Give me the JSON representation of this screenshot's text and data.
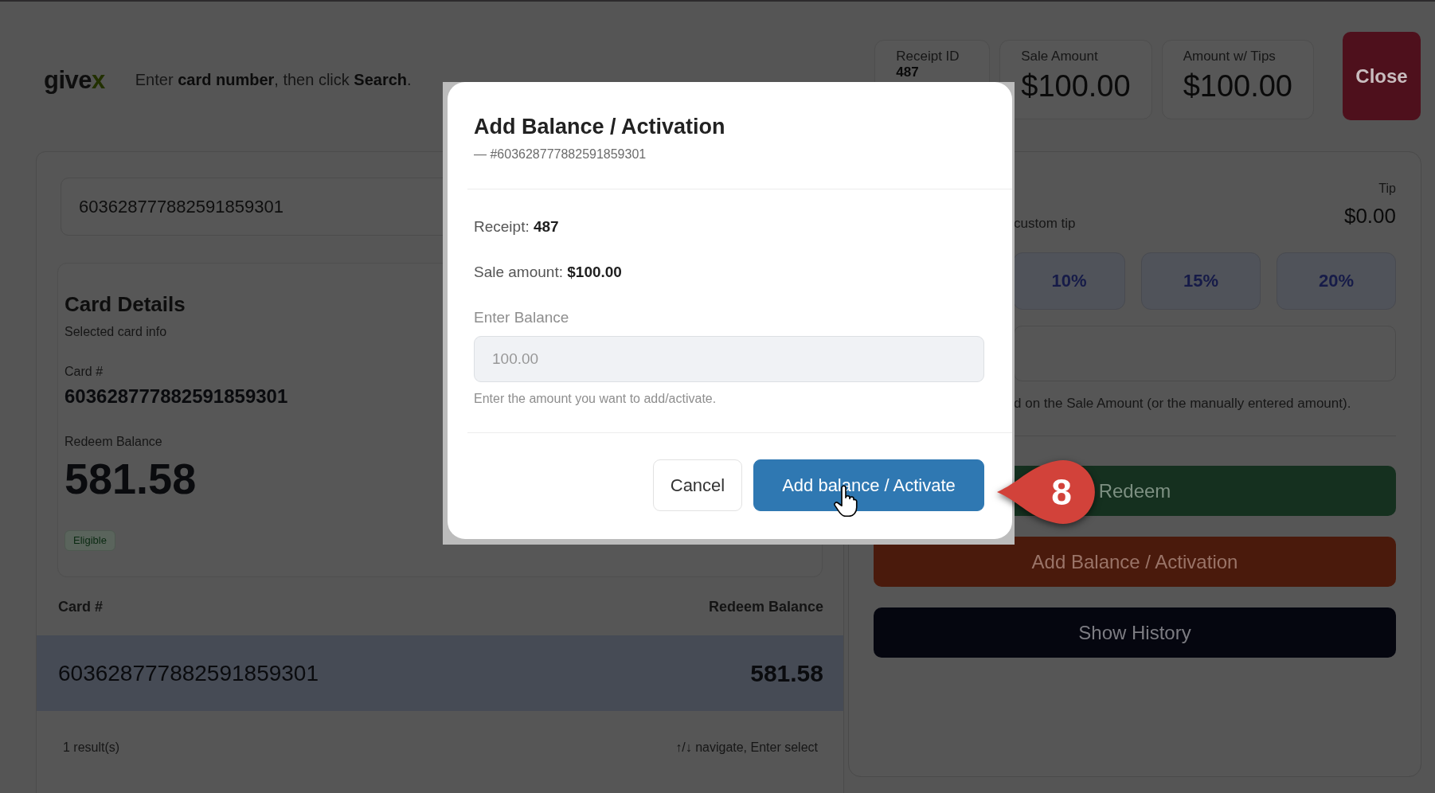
{
  "header": {
    "logo": {
      "text": "give",
      "accent": "x"
    },
    "hint": "Enter **card number**, then click **Search**.",
    "stats": [
      {
        "label": "Receipt ID",
        "value": "487",
        "kind": "small"
      },
      {
        "label": "Sale Amount",
        "value": "$100.00",
        "kind": "large"
      },
      {
        "label": "Amount w/ Tips",
        "value": "$100.00",
        "kind": "large"
      }
    ],
    "close_button": "Close"
  },
  "search": {
    "value": "603628777882591859301"
  },
  "card_details": {
    "title": "Card Details",
    "subtitle": "Selected card info",
    "fields": [
      {
        "label": "Card #",
        "value": "603628777882591859301",
        "kind": "text"
      },
      {
        "label": "Redeem Balance",
        "value": "581.58",
        "kind": "amount"
      }
    ],
    "badge": "Eligible"
  },
  "results": {
    "columns": [
      "Card #",
      "Redeem Balance"
    ],
    "rows": [
      {
        "card": "603628777882591859301",
        "balance": "581.58",
        "selected": true
      }
    ],
    "count": "1 result(s)",
    "hint": "↑/↓ navigate, Enter select"
  },
  "tip": {
    "label": "Tip",
    "amount": "$0.00",
    "prompt": "custom tip",
    "presets": [
      {
        "label": "10%",
        "selected": false
      },
      {
        "label": "15%",
        "selected": false
      },
      {
        "label": "20%",
        "selected": false
      }
    ],
    "note": "d on the Sale Amount (or the manually entered amount)."
  },
  "actions": [
    {
      "label": "Redeem",
      "kind": "redeem"
    },
    {
      "label": "Add Balance / Activation",
      "kind": "activate"
    },
    {
      "label": "Show History",
      "kind": "history"
    }
  ],
  "modal": {
    "title": "Add Balance / Activation",
    "subtitle": "— #603628777882591859301",
    "lines": [
      "Receipt: **487**",
      "Sale amount: **$100.00**"
    ],
    "field": {
      "label": "Enter Balance",
      "placeholder": "100.00",
      "help": "Enter the amount you want to add/activate."
    },
    "buttons": [
      {
        "label": "Cancel",
        "kind": "secondary"
      },
      {
        "label": "Add balance / Activate",
        "kind": "primary"
      }
    ]
  },
  "step_marker": {
    "label": "8"
  }
}
